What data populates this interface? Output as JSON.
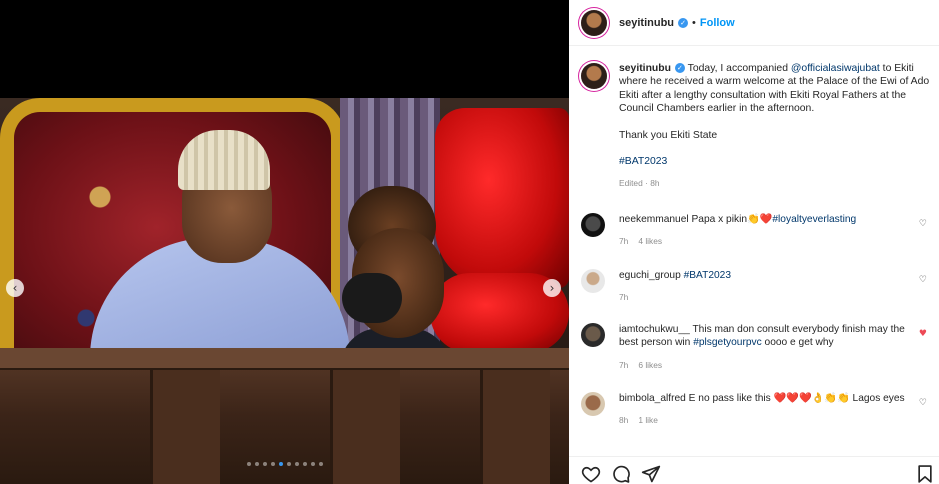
{
  "media": {
    "carousel_prev": "‹",
    "carousel_next": "›",
    "dot_count": 10,
    "active_dot": 5
  },
  "header": {
    "username": "seyitinubu",
    "separator": "•",
    "follow_label": "Follow"
  },
  "caption": {
    "username": "seyitinubu",
    "text_before": "Today, I accompanied ",
    "mention": "@officialasiwajubat",
    "text_after": " to Ekiti where he received a warm welcome at the Palace of the Ewi of Ado Ekiti after a lengthy consultation with Ekiti Royal Fathers at the Council Chambers earlier in the afternoon.",
    "line2": "Thank you Ekiti State",
    "hashtag": "#BAT2023",
    "meta": "Edited · 8h"
  },
  "comments": [
    {
      "username": "neekemmanuel",
      "text": "Papa x pikin",
      "emojis": "👏❤️",
      "tag": "#loyaltyeverlasting",
      "time": "7h",
      "likes": "4 likes",
      "liked": false
    },
    {
      "username": "eguchi_group",
      "text": "",
      "emojis": "",
      "tag": "#BAT2023",
      "time": "7h",
      "likes": "",
      "liked": false
    },
    {
      "username": "iamtochukwu__",
      "text": "This man don consult everybody finish may the best person win ",
      "emojis": "",
      "tag": "#plsgetyourpvc",
      "text_after": " oooo e get why",
      "time": "7h",
      "likes": "6 likes",
      "liked": true
    },
    {
      "username": "bimbola_alfred",
      "text": "E no pass like this ",
      "emojis": "❤️❤️❤️👌👏👏",
      "text_after": " Lagos eyes",
      "time": "8h",
      "likes": "1 like",
      "liked": false
    }
  ],
  "icons": {
    "heart": "♡",
    "heart_filled": "♥"
  },
  "colors": {
    "link": "#0095f6",
    "mention": "#00376b",
    "liked": "#ed4956",
    "muted": "#8e8e8e"
  }
}
